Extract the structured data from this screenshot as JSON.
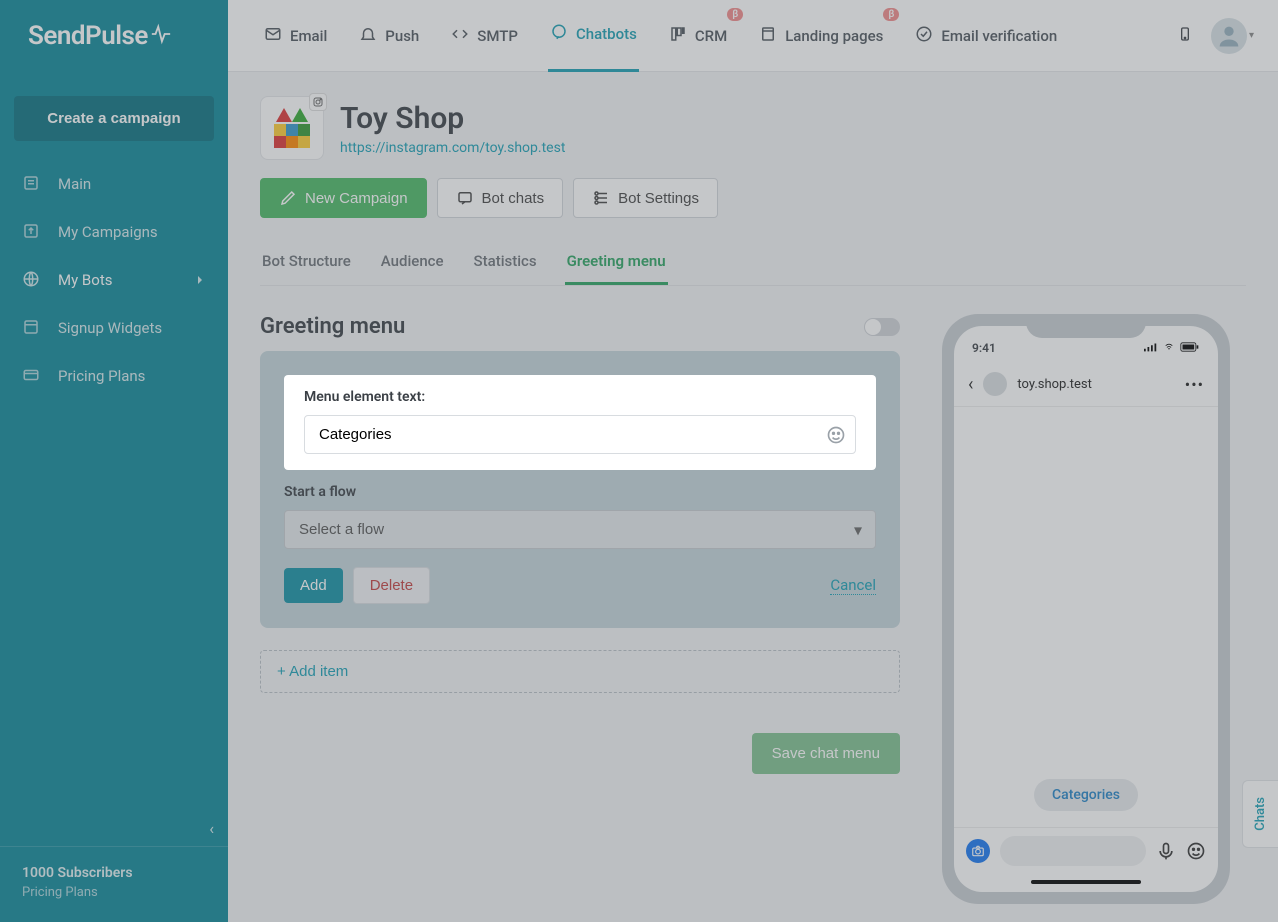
{
  "brand": "SendPulse",
  "sidebar": {
    "create_label": "Create a campaign",
    "items": [
      {
        "label": "Main"
      },
      {
        "label": "My Campaigns"
      },
      {
        "label": "My Bots"
      },
      {
        "label": "Signup Widgets"
      },
      {
        "label": "Pricing Plans"
      }
    ],
    "footer_title": "1000 Subscribers",
    "footer_sub": "Pricing Plans"
  },
  "topnav": {
    "items": [
      {
        "label": "Email"
      },
      {
        "label": "Push"
      },
      {
        "label": "SMTP"
      },
      {
        "label": "Chatbots",
        "active": true
      },
      {
        "label": "CRM",
        "beta": true
      },
      {
        "label": "Landing pages",
        "beta": true
      },
      {
        "label": "Email verification"
      }
    ],
    "beta_badge": "β"
  },
  "page": {
    "title": "Toy Shop",
    "url": "https://instagram.com/toy.shop.test",
    "actions": {
      "new_campaign": "New Campaign",
      "bot_chats": "Bot chats",
      "bot_settings": "Bot Settings"
    },
    "tabs": [
      {
        "label": "Bot Structure"
      },
      {
        "label": "Audience"
      },
      {
        "label": "Statistics"
      },
      {
        "label": "Greeting menu",
        "active": true
      }
    ]
  },
  "greeting": {
    "section_title": "Greeting menu",
    "menu_text_label": "Menu element text:",
    "menu_text_value": "Categories",
    "start_flow_label": "Start a flow",
    "start_flow_placeholder": "Select a flow",
    "add_label": "Add",
    "delete_label": "Delete",
    "cancel_label": "Cancel",
    "add_item_label": "+ Add item",
    "save_label": "Save chat menu"
  },
  "phone": {
    "time": "9:41",
    "profile_name": "toy.shop.test",
    "chip_label": "Categories"
  },
  "chats_tab": "Chats"
}
